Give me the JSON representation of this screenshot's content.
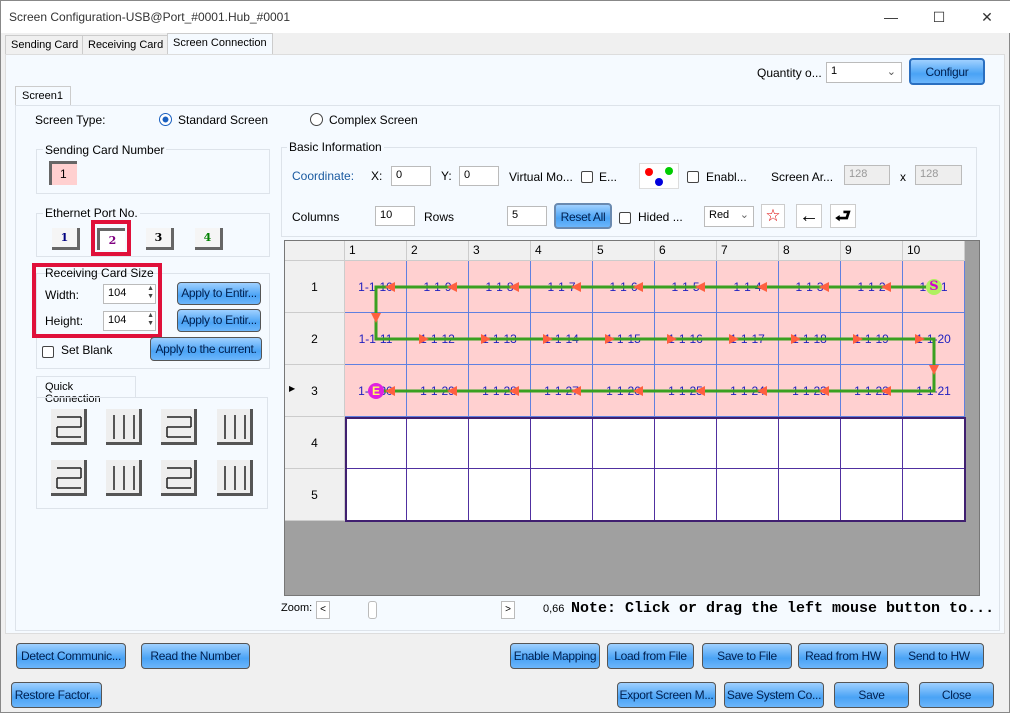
{
  "window": {
    "title": "Screen Configuration-USB@Port_#0001.Hub_#0001",
    "minimize_icon": "minimize-icon",
    "maximize_icon": "maximize-icon",
    "close_icon": "close-icon"
  },
  "tabs": [
    {
      "label": "Sending Card"
    },
    {
      "label": "Receiving Card"
    },
    {
      "label": "Screen Connection",
      "active": true
    }
  ],
  "top": {
    "quantity_label": "Quantity o...",
    "quantity_value": "1",
    "configure_label": "Configur"
  },
  "screen_tab": "Screen1",
  "screen_type": {
    "label": "Screen Type:",
    "standard": "Standard Screen",
    "complex": "Complex Screen",
    "selected": "standard"
  },
  "sending_card": {
    "label": "Sending Card Number",
    "value": "1"
  },
  "ethernet": {
    "label": "Ethernet Port No.",
    "ports": [
      "1",
      "2",
      "3",
      "4"
    ],
    "selected": "2",
    "port_colors": [
      "#000080",
      "#800080",
      "#000000",
      "#008000"
    ]
  },
  "receiving_size": {
    "label": "Receiving Card Size",
    "width_label": "Width:",
    "width": "104",
    "height_label": "Height:",
    "height": "104",
    "apply_width": "Apply to Entir...",
    "apply_height": "Apply to Entir...",
    "set_blank": "Set Blank",
    "apply_current": "Apply to the current."
  },
  "quick_connection": {
    "label": "Quick Connection"
  },
  "basic": {
    "label": "Basic Information",
    "coordinate": "Coordinate:",
    "x_label": "X:",
    "x": "0",
    "y_label": "Y:",
    "y": "0",
    "virtual": "Virtual Mo...",
    "e_label": "E...",
    "enable_label": "Enabl...",
    "screen_area": "Screen Ar...",
    "area_w": "128",
    "area_x": "x",
    "area_h": "128",
    "columns_label": "Columns",
    "columns": "10",
    "rows_label": "Rows",
    "rows": "5",
    "reset_all": "Reset All",
    "hided": "Hided ...",
    "color": "Red"
  },
  "grid": {
    "col_headers": [
      "1",
      "2",
      "3",
      "4",
      "5",
      "6",
      "7",
      "8",
      "9",
      "10"
    ],
    "row_headers": [
      "1",
      "2",
      "3",
      "4",
      "5"
    ],
    "cells": [
      [
        "1-1-10",
        "1-1-9",
        "1-1-8",
        "1-1-7",
        "1-1-6",
        "1-1-5",
        "1-1-4",
        "1-1-3",
        "1-1-2",
        "1-1-1"
      ],
      [
        "1-1-11",
        "1-1-12",
        "1-1-13",
        "1-1-14",
        "1-1-15",
        "1-1-16",
        "1-1-17",
        "1-1-18",
        "1-1-19",
        "1-1-20"
      ],
      [
        "1-1-30",
        "1-1-29",
        "1-1-28",
        "1-1-27",
        "1-1-26",
        "1-1-25",
        "1-1-24",
        "1-1-23",
        "1-1-22",
        "1-1-21"
      ]
    ],
    "start_marker": "S",
    "end_marker": "E",
    "filled_color": "#ffd0d0",
    "path_color": "#3aa020",
    "arrow_color": "#ff6040"
  },
  "zoom": {
    "label": "Zoom:",
    "left": "<",
    "right": ">",
    "value": "0,66",
    "note": "Note: Click or drag the left mouse button to..."
  },
  "buttons_row1": {
    "detect": "Detect Communic...",
    "read_number": "Read the Number",
    "enable_mapping": "Enable Mapping",
    "load": "Load from File",
    "save_file": "Save to File",
    "read_hw": "Read from HW",
    "send_hw": "Send to HW"
  },
  "buttons_row2": {
    "restore": "Restore Factor...",
    "export": "Export Screen M...",
    "save_system": "Save System Co...",
    "save": "Save",
    "close": "Close"
  }
}
